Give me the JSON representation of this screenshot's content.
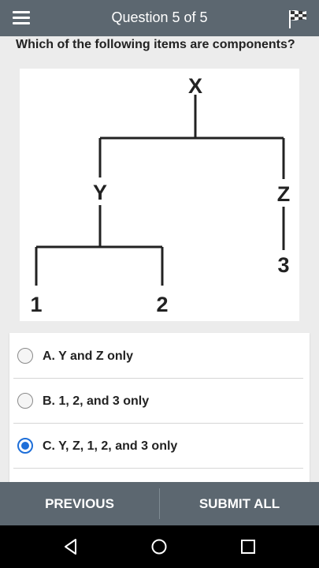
{
  "header": {
    "title": "Question 5 of 5",
    "menu_icon": "hamburger-menu-icon",
    "flag_icon": "checkered-flag-icon"
  },
  "question": {
    "text": "Which of the following items are components?"
  },
  "diagram": {
    "root": "X",
    "left_child": "Y",
    "right_child": "Z",
    "right_grandchild": "3",
    "left_grandchild_1": "1",
    "left_grandchild_2": "2"
  },
  "answers": [
    {
      "label": "A. Y and Z only",
      "selected": false
    },
    {
      "label": "B. 1, 2, and 3 only",
      "selected": false
    },
    {
      "label": "C. Y, Z, 1, 2, and 3 only",
      "selected": true
    }
  ],
  "footer": {
    "previous_label": "PREVIOUS",
    "submit_label": "SUBMIT ALL"
  },
  "colors": {
    "bar": "#5c6770",
    "accent": "#1e6fd9"
  },
  "system_nav": {
    "back_icon": "back-triangle-icon",
    "home_icon": "home-circle-icon",
    "recents_icon": "recents-square-icon"
  }
}
